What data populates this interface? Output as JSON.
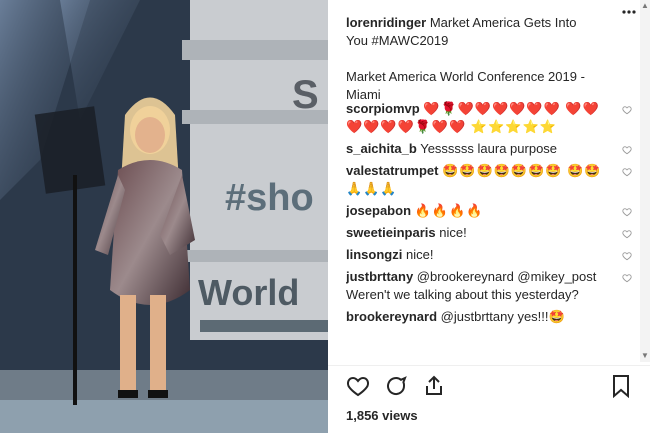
{
  "post": {
    "username": "lorenridinger",
    "caption_line1": "Market America Gets Into",
    "caption_line2": "You #MAWC2019",
    "caption_line3": "Market America World Conference 2019 -",
    "caption_line4": "Miami"
  },
  "photo": {
    "screen_letter": "S",
    "screen_hashtag": "#sho",
    "screen_world": "World"
  },
  "comments": [
    {
      "user": "scorpiomvp",
      "text": "❤️🌹❤️❤️❤️❤️❤️❤️ ❤️❤️❤️❤️❤️❤️🌹❤️❤️ ⭐⭐⭐⭐⭐"
    },
    {
      "user": "s_aichita_b",
      "text": "Yessssss laura purpose"
    },
    {
      "user": "valestatrumpet",
      "text": "🤩🤩🤩🤩🤩🤩🤩 🤩🤩🙏🙏🙏"
    },
    {
      "user": "josepabon",
      "text": "🔥🔥🔥🔥"
    },
    {
      "user": "sweetieinparis",
      "text": "nice!"
    },
    {
      "user": "linsongzi",
      "text": "nice!"
    },
    {
      "user": "justbrttany",
      "text": "@brookereynard @mikey_post Weren't we talking about this yesterday?"
    },
    {
      "user": "brookereynard",
      "text": "@justbrttany yes!!!🤩"
    }
  ],
  "stats": {
    "views": "1,856 views"
  },
  "icons": {
    "like": "heart-icon",
    "comment": "comment-icon",
    "share": "share-icon",
    "save": "bookmark-icon",
    "more": "more-options-icon"
  },
  "colors": {
    "text": "#262626",
    "icon": "#999999"
  }
}
